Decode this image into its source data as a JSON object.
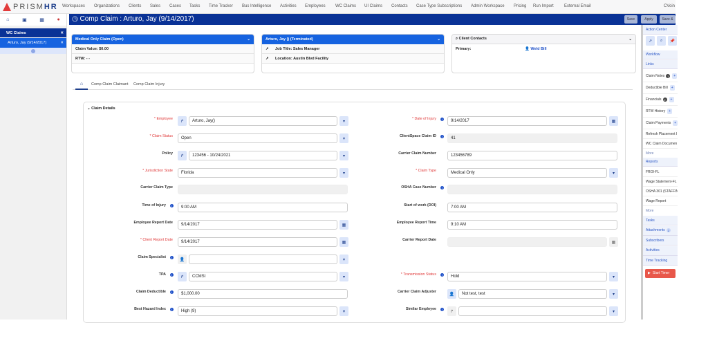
{
  "brand": {
    "name_light": "PRISM",
    "name_bold": "HR"
  },
  "nav": [
    "Workspaces",
    "Organizations",
    "Clients",
    "Sales",
    "Cases",
    "Tasks",
    "Time Tracker",
    "Bus Intelligence",
    "Activities",
    "Employees",
    "WC Claims",
    "UI Claims",
    "Contacts",
    "Case Type Subscriptions",
    "Admin Workspace",
    "Pricing",
    "Run Import",
    "External Email"
  ],
  "user": "CVoin",
  "sidebar": {
    "section": "WC Claims",
    "selected": "Arturo, Jay (9/14/2017)",
    "close": "✕"
  },
  "title": "Comp Claim : Arturo, Jay (9/14/2017)",
  "toolbar": {
    "save": "Save",
    "apply": "Apply",
    "save_close": "Save &"
  },
  "cards": {
    "claim": {
      "title": "Medical Only Claim (Open)",
      "value": "Claim Value: $0.00",
      "rtw": "RTW: - -"
    },
    "employee": {
      "title": "Arturo, Jay () (Terminated)",
      "job": "Job Title: Sales Manager",
      "location": "Location: Austin Blvd Facility"
    },
    "contacts": {
      "title": "Client Contacts",
      "primary_label": "Primary:",
      "primary_value": "Weld Bill"
    }
  },
  "tabs": [
    "Comp Claim Claimant",
    "Comp Claim Injury"
  ],
  "section_title": "Claim Details",
  "left_fields": [
    {
      "label": "* Employee",
      "required": true,
      "value": "Arturo, Jay()",
      "pre": "link",
      "post": "dropdown"
    },
    {
      "label": "* Claim Status",
      "required": true,
      "value": "Open",
      "post": "dropdown"
    },
    {
      "label": "Policy",
      "value": "123456 - 10/24/2021",
      "pre": "link",
      "post": "dropdown"
    },
    {
      "label": "* Jurisdiction State",
      "required": true,
      "value": "Florida",
      "post": "dropdown"
    },
    {
      "label": "Carrier Claim Type",
      "value": "",
      "readonly": true
    },
    {
      "label": "Time of Injury",
      "info": true,
      "value": "9:00 AM"
    },
    {
      "label": "Employee Report Date",
      "value": "9/14/2017",
      "post": "calendar"
    },
    {
      "label": "* Client Report Date",
      "required": true,
      "value": "9/14/2017",
      "post": "calendar"
    },
    {
      "label": "Claim Specialist",
      "info": true,
      "value": "",
      "pre": "person-grey",
      "post": "dropdown"
    },
    {
      "label": "TPA",
      "info": true,
      "value": "CCMSI",
      "pre": "link",
      "post": "dropdown"
    },
    {
      "label": "Claim Deductible",
      "info": true,
      "value": "$1,000.00"
    },
    {
      "label": "Best Hazard Index",
      "info": true,
      "value": "High (9)",
      "post": "dropdown"
    }
  ],
  "right_fields": [
    {
      "label": "* Date of Injury",
      "required": true,
      "info": true,
      "value": "9/14/2017",
      "post": "calendar"
    },
    {
      "label": "ClientSpace Claim ID",
      "info": true,
      "value": "41",
      "readonly": true
    },
    {
      "label": "Carrier Claim Number",
      "value": "123456789"
    },
    {
      "label": "* Claim Type",
      "required": true,
      "value": "Medical Only",
      "post": "dropdown"
    },
    {
      "label": "OSHA Case Number",
      "info": true,
      "value": "",
      "readonly": true
    },
    {
      "label": "Start of work (DOI)",
      "value": "7:00 AM"
    },
    {
      "label": "Employee Report Time",
      "value": "9:10 AM"
    },
    {
      "label": "Carrier Report Date",
      "value": "",
      "readonly": true,
      "post": "calendar-grey"
    },
    null,
    {
      "label": "* Transmission Status",
      "required": true,
      "info": true,
      "value": "Hold",
      "post": "dropdown"
    },
    {
      "label": "Carrier Claim Adjuster",
      "value": "Not test, test",
      "pre": "person",
      "post": "dropdown"
    },
    {
      "label": "Similar Employee",
      "info": true,
      "value": "",
      "pre": "link-grey",
      "post": "dropdown"
    }
  ],
  "right_panel": {
    "action_center": "Action Center",
    "workflow": "Workflow",
    "links": "Links",
    "link_items": [
      {
        "label": "Claim Notes",
        "badge": "1",
        "plus": true
      },
      {
        "label": "Deductible Bill",
        "plus": true
      },
      {
        "label": "Financials",
        "badge": "2",
        "plus": true
      },
      {
        "label": "RTW History",
        "plus": true
      },
      {
        "label": "Claim Payments",
        "plus": true
      },
      {
        "label": "Refresh Placement I"
      },
      {
        "label": "WC Claim Documen"
      }
    ],
    "more": "More",
    "reports": "Reports",
    "report_items": [
      "FROI-FL",
      "Wage Statement-FL",
      "OSHA 301 (STAFFING)",
      "Wage Report"
    ],
    "sections": [
      {
        "label": "Tasks"
      },
      {
        "label": "Attachments",
        "badge": "2"
      },
      {
        "label": "Subscribers"
      },
      {
        "label": "Activities"
      },
      {
        "label": "Time Tracking"
      }
    ],
    "start_timer": "Start Timer"
  }
}
